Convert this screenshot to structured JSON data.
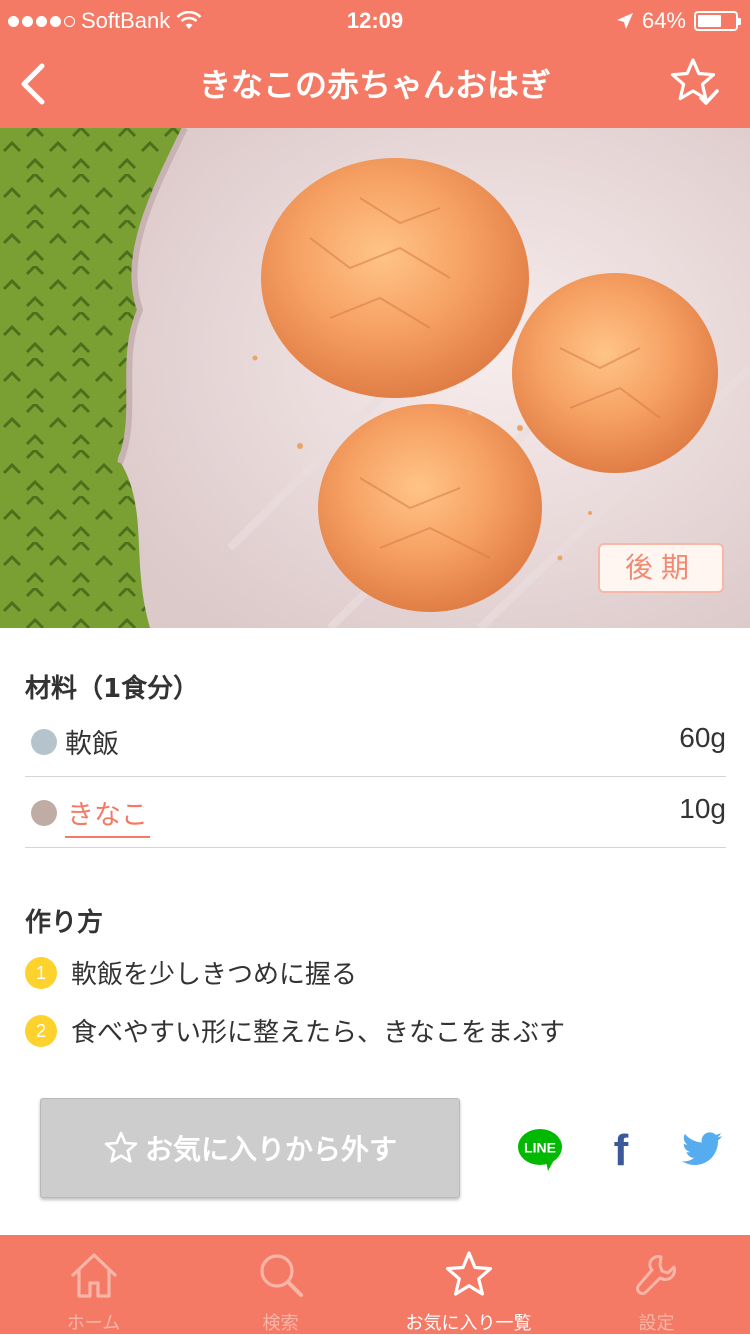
{
  "status_bar": {
    "carrier": "SoftBank",
    "time": "12:09",
    "battery_percent": "64%",
    "battery_level": 0.64,
    "signal_bars_filled": 4,
    "signal_bars_total": 5
  },
  "nav": {
    "title": "きなこの赤ちゃんおはぎ",
    "back_icon": "chevron-left-icon",
    "favorite_icon": "star-check-icon"
  },
  "hero": {
    "badge": "後期"
  },
  "ingredients": {
    "title": "材料（1食分）",
    "items": [
      {
        "name": "軟飯",
        "amount": "60g",
        "dot_color": "#b5c4cc",
        "is_link": false
      },
      {
        "name": "きなこ",
        "amount": "10g",
        "dot_color": "#bfaca5",
        "is_link": true
      }
    ]
  },
  "steps": {
    "title": "作り方",
    "items": [
      {
        "number": "1",
        "text": "軟飯を少しきつめに握る"
      },
      {
        "number": "2",
        "text": "食べやすい形に整えたら、きなこをまぶす"
      }
    ]
  },
  "actions": {
    "remove_favorite_label": "お気に入りから外す",
    "share": [
      "LINE",
      "f"
    ]
  },
  "tab_bar": {
    "active_index": 2,
    "items": [
      {
        "label": "ホーム",
        "icon": "home-icon"
      },
      {
        "label": "検索",
        "icon": "search-icon"
      },
      {
        "label": "お気に入り一覧",
        "icon": "star-icon"
      },
      {
        "label": "設定",
        "icon": "wrench-icon"
      }
    ]
  },
  "colors": {
    "brand": "#f47a65",
    "step_badge": "#fdd22c",
    "button_gray": "#cdcdcd",
    "line_green": "#00b900",
    "facebook_blue": "#3b5998",
    "twitter_blue": "#55acee"
  }
}
